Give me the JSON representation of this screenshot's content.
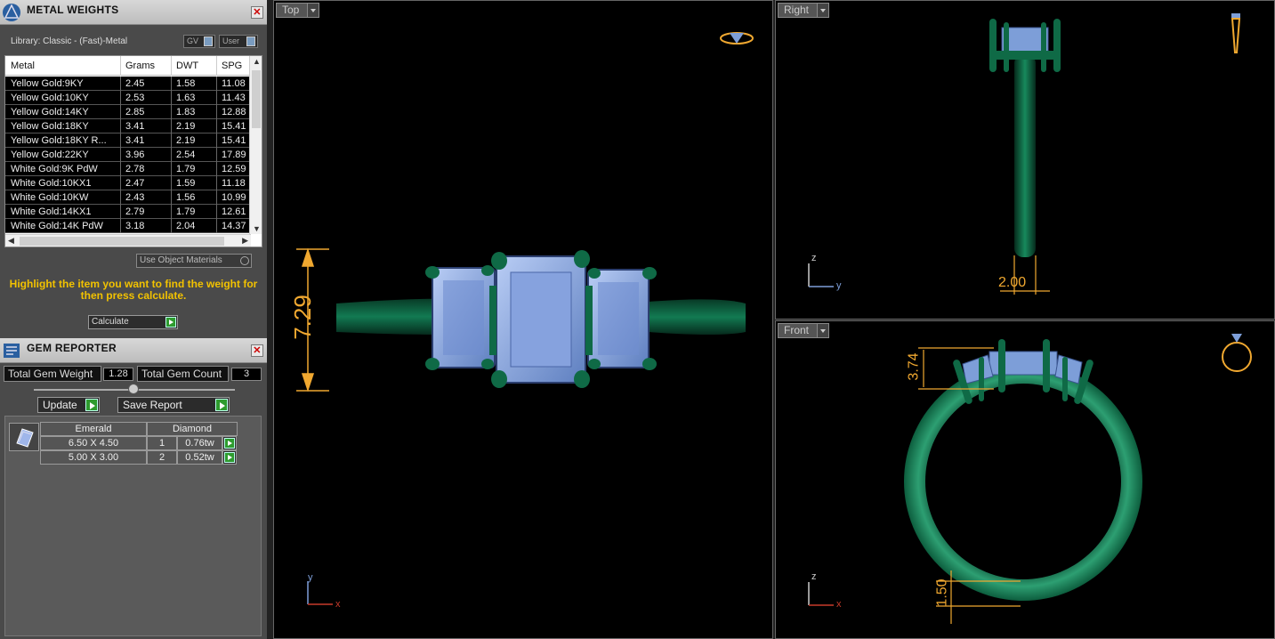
{
  "metal_weights": {
    "title": "METAL WEIGHTS",
    "library": "Library: Classic - (Fast)-Metal",
    "toggle_gv": "GV",
    "toggle_user": "User",
    "columns": [
      "Metal",
      "Grams",
      "DWT",
      "SPG"
    ],
    "rows": [
      [
        "Yellow Gold:9KY",
        "2.45",
        "1.58",
        "11.08"
      ],
      [
        "Yellow Gold:10KY",
        "2.53",
        "1.63",
        "11.43"
      ],
      [
        "Yellow Gold:14KY",
        "2.85",
        "1.83",
        "12.88"
      ],
      [
        "Yellow Gold:18KY",
        "3.41",
        "2.19",
        "15.41"
      ],
      [
        "Yellow Gold:18KY R...",
        "3.41",
        "2.19",
        "15.41"
      ],
      [
        "Yellow Gold:22KY",
        "3.96",
        "2.54",
        "17.89"
      ],
      [
        "White Gold:9K PdW",
        "2.78",
        "1.79",
        "12.59"
      ],
      [
        "White Gold:10KX1",
        "2.47",
        "1.59",
        "11.18"
      ],
      [
        "White Gold:10KW",
        "2.43",
        "1.56",
        "10.99"
      ],
      [
        "White Gold:14KX1",
        "2.79",
        "1.79",
        "12.61"
      ],
      [
        "White Gold:14K PdW",
        "3.18",
        "2.04",
        "14.37"
      ]
    ],
    "use_object_materials": "Use Object Materials",
    "hint": "Highlight the item you want to find the weight for then press calculate.",
    "calculate": "Calculate"
  },
  "gem_reporter": {
    "title": "GEM REPORTER",
    "total_weight_label": "Total Gem Weight",
    "total_weight_value": "1.28",
    "total_count_label": "Total Gem Count",
    "total_count_value": "3",
    "update": "Update",
    "save_report": "Save Report",
    "headers": [
      "Emerald",
      "Diamond"
    ],
    "gems": [
      {
        "size": "6.50 X 4.50",
        "count": "1",
        "tw": "0.76tw"
      },
      {
        "size": "5.00 X 3.00",
        "count": "2",
        "tw": "0.52tw"
      }
    ]
  },
  "viewports": {
    "top": {
      "label": "Top",
      "dimension": "7.29",
      "axis_v": "y",
      "axis_h": "x"
    },
    "right": {
      "label": "Right",
      "dimension": "2.00",
      "axis_v": "z",
      "axis_h": "y"
    },
    "front": {
      "label": "Front",
      "dimension_top": "3.74",
      "dimension_bottom": "1.50",
      "axis_v": "z",
      "axis_h": "x"
    }
  },
  "colors": {
    "metal": "#0e6e4a",
    "gem": "#7d9ed8",
    "dimension": "#f0a830",
    "hint": "#f2c200"
  }
}
